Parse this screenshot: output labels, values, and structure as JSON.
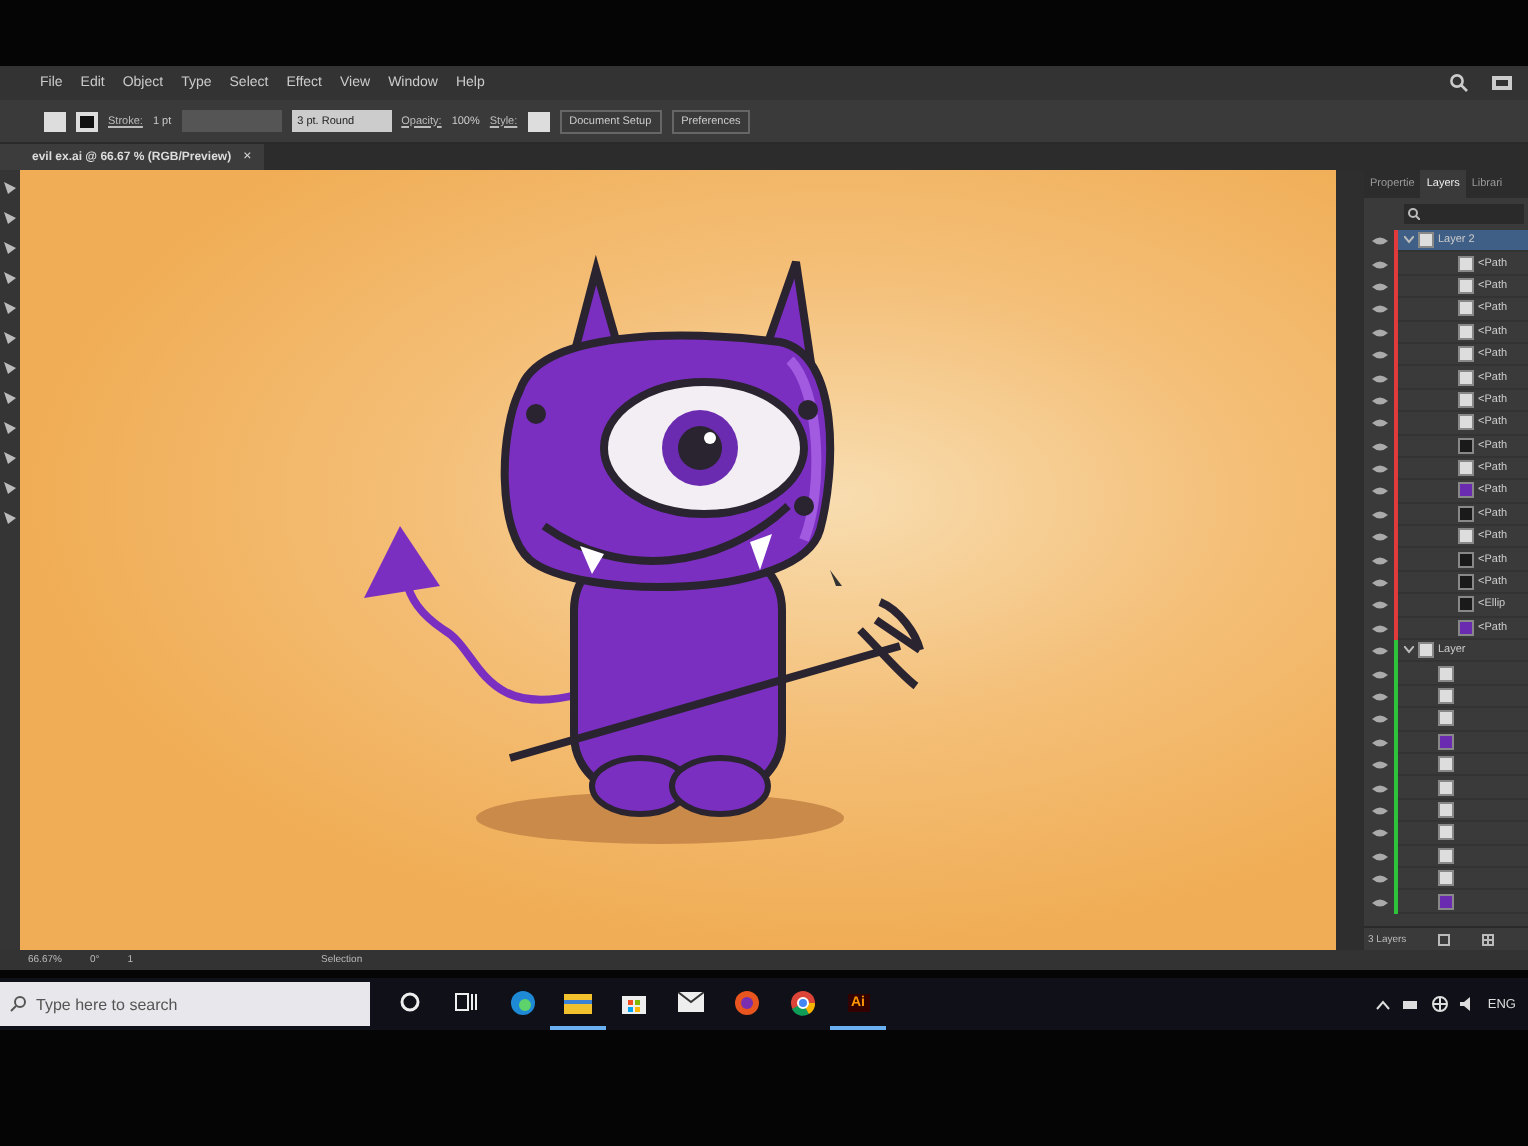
{
  "menu": [
    "File",
    "Edit",
    "Object",
    "Type",
    "Select",
    "Effect",
    "View",
    "Window",
    "Help"
  ],
  "control_bar": {
    "stroke_label": "Stroke:",
    "stroke_weight": "1 pt",
    "brush": "3 pt. Round",
    "opacity_label": "Opacity:",
    "opacity": "100%",
    "style_label": "Style:",
    "buttons": [
      "Document Setup",
      "Preferences"
    ]
  },
  "document_tab": {
    "title": "evil ex.ai @ 66.67 % (RGB/Preview)",
    "close": "×"
  },
  "panel": {
    "tabs": [
      {
        "label": "Propertie",
        "selected": false
      },
      {
        "label": "Layers",
        "selected": true
      },
      {
        "label": "Librari",
        "selected": false
      }
    ],
    "layers": [
      {
        "name": "Layer 2",
        "expanded": true,
        "selected": true,
        "color": "#e03a3a",
        "children": [
          {
            "name": "<Path",
            "kind": "light"
          },
          {
            "name": "<Path",
            "kind": "light"
          },
          {
            "name": "<Path",
            "kind": "light"
          },
          {
            "name": "<Path",
            "kind": "light"
          },
          {
            "name": "<Path",
            "kind": "light"
          },
          {
            "name": "<Path",
            "kind": "light"
          },
          {
            "name": "<Path",
            "kind": "light"
          },
          {
            "name": "<Path",
            "kind": "light"
          },
          {
            "name": "<Path",
            "kind": "dark"
          },
          {
            "name": "<Path",
            "kind": "light"
          },
          {
            "name": "<Path",
            "kind": "purple"
          },
          {
            "name": "<Path",
            "kind": "dark"
          },
          {
            "name": "<Path",
            "kind": "light"
          },
          {
            "name": "<Path",
            "kind": "dark"
          },
          {
            "name": "<Path",
            "kind": "dark"
          },
          {
            "name": "<Ellip",
            "kind": "dark"
          },
          {
            "name": "<Path",
            "kind": "purple"
          }
        ]
      },
      {
        "name": "Layer",
        "expanded": true,
        "selected": false,
        "color": "#2ec43a",
        "children": [
          {
            "kind": "light"
          },
          {
            "kind": "light"
          },
          {
            "kind": "light"
          },
          {
            "kind": "purple"
          },
          {
            "kind": "light"
          },
          {
            "kind": "light"
          },
          {
            "kind": "light"
          },
          {
            "kind": "light"
          },
          {
            "kind": "light"
          },
          {
            "kind": "light"
          },
          {
            "kind": "purple"
          }
        ]
      }
    ],
    "footer": "3 Layers"
  },
  "status_bar": {
    "zoom": "66.67%",
    "rotation": "0°",
    "artboard": "1",
    "tool": "Selection"
  },
  "taskbar": {
    "search_placeholder": "Type here to search",
    "apps": [
      {
        "kind": "cortana",
        "selected": false
      },
      {
        "kind": "taskview",
        "selected": false
      },
      {
        "kind": "edge",
        "selected": false
      },
      {
        "kind": "explorer",
        "selected": true
      },
      {
        "kind": "store",
        "selected": false
      },
      {
        "kind": "mail",
        "selected": false
      },
      {
        "kind": "firefox",
        "selected": false
      },
      {
        "kind": "chrome",
        "selected": false
      },
      {
        "kind": "illustrator",
        "label": "Ai",
        "selected": true
      }
    ],
    "language": "ENG"
  }
}
